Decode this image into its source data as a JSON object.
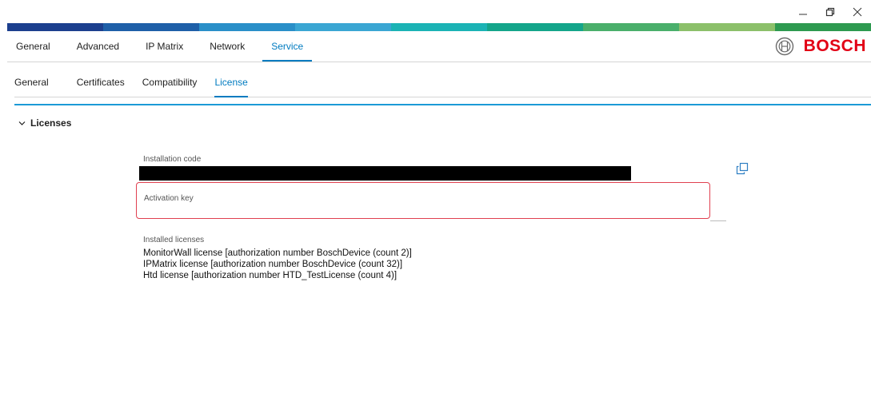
{
  "window": {
    "minimize_icon": "minimize-icon",
    "restore_icon": "restore-icon",
    "close_icon": "close-icon"
  },
  "brand": {
    "logo_text": "BOSCH",
    "stripe_colors": [
      "#1c3f8e",
      "#1e5fa8",
      "#2a8fc8",
      "#3aa6d3",
      "#1bb3b5",
      "#14a58a",
      "#4aaf6b",
      "#8cc06a",
      "#2e9a50"
    ]
  },
  "main_tabs": [
    {
      "label": "General"
    },
    {
      "label": "Advanced"
    },
    {
      "label": "IP Matrix"
    },
    {
      "label": "Network"
    },
    {
      "label": "Service",
      "active": true
    }
  ],
  "sub_tabs": [
    {
      "label": "General"
    },
    {
      "label": "Certificates"
    },
    {
      "label": "Compatibility"
    },
    {
      "label": "License",
      "active": true
    }
  ],
  "licenses_section": {
    "title": "Licenses",
    "installation_code_label": "Installation code",
    "activation_key_label": "Activation key",
    "activation_key_value": "",
    "installed_licenses_label": "Installed licenses",
    "installed_licenses": [
      "MonitorWall license [authorization number BoschDevice (count 2)]",
      "IPMatrix license [authorization number BoschDevice (count 32)]",
      "Htd license [authorization number HTD_TestLicense (count 4)]"
    ]
  },
  "colors": {
    "accent": "#007bc0",
    "section_rule": "#1b9ad6",
    "logo_red": "#e20015",
    "error_border": "#e04050"
  }
}
